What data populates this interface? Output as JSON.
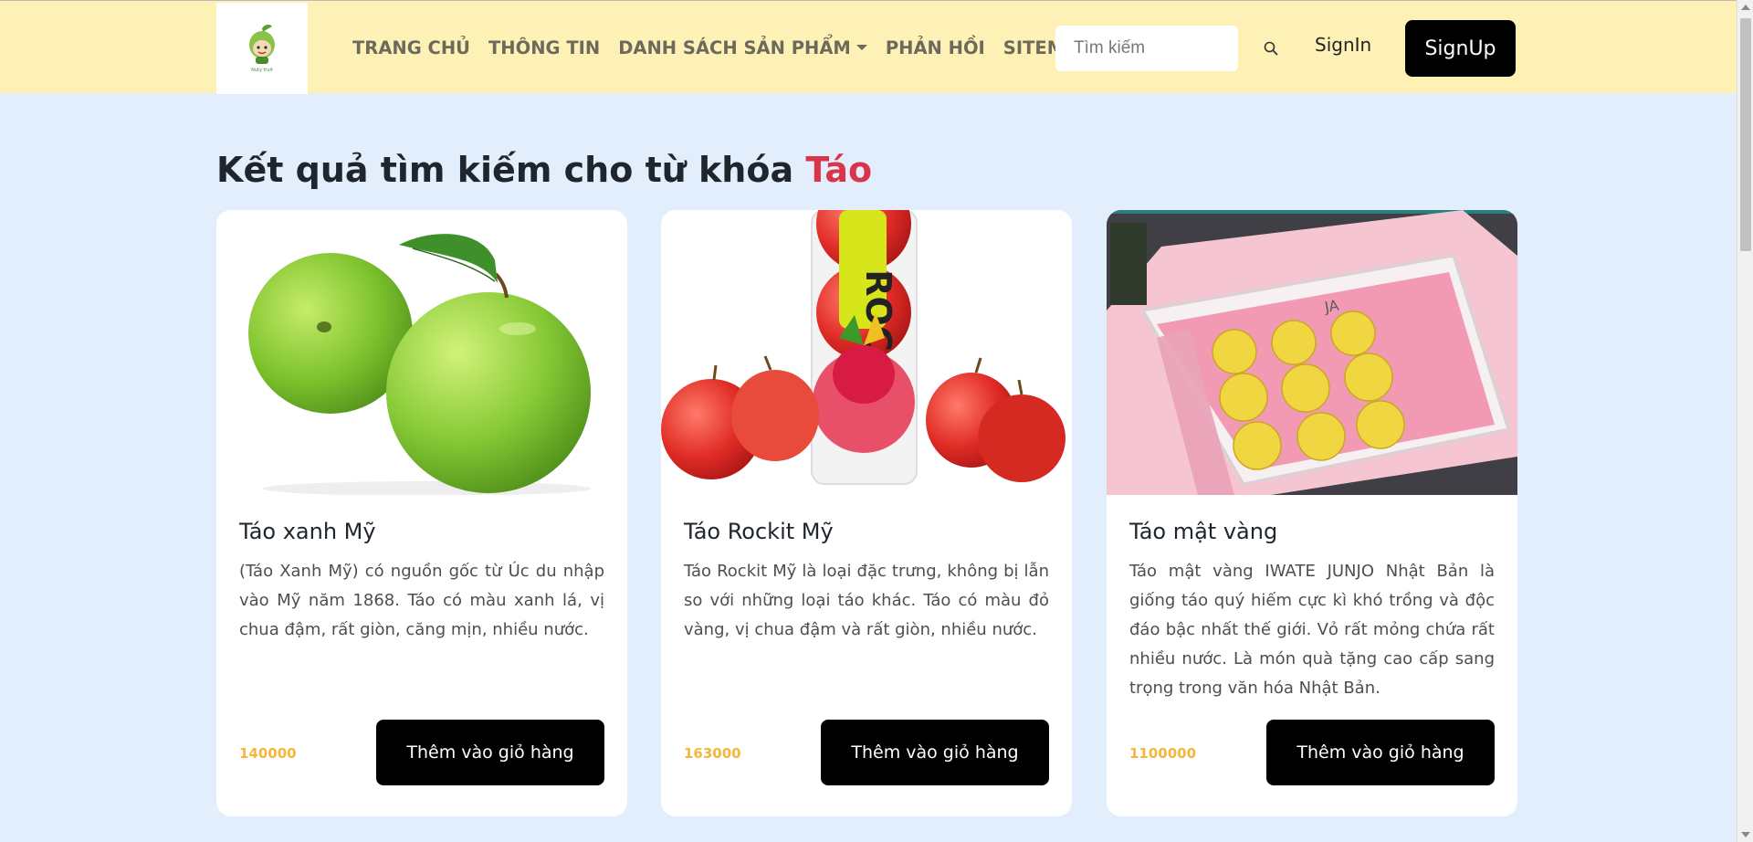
{
  "header": {
    "logo_icon": "fruit-shop-logo-icon",
    "nav": [
      {
        "label": "TRANG CHỦ"
      },
      {
        "label": "THÔNG TIN"
      },
      {
        "label": "DANH SÁCH SẢN PHẨM",
        "dropdown": true
      },
      {
        "label": "PHẢN HỒI"
      },
      {
        "label": "SITEMAP"
      }
    ],
    "search_placeholder": "Tìm kiếm",
    "search_icon": "search-icon",
    "signin_label": "SignIn",
    "signup_label": "SignUp"
  },
  "main": {
    "title_prefix": "Kết quả tìm kiếm cho từ khóa",
    "keyword": "Táo"
  },
  "products": [
    {
      "name": "Táo xanh Mỹ",
      "description": "(Táo Xanh Mỹ) có nguồn gốc từ Úc du nhập vào Mỹ năm 1868. Táo có màu xanh lá, vị chua đậm, rất giòn, căng mịn, nhiều nước.",
      "price": "140000",
      "button_label": "Thêm vào giỏ hàng"
    },
    {
      "name": "Táo Rockit Mỹ",
      "description": "Táo Rockit Mỹ là loại đặc trưng, không bị lẫn so với những loại táo khác. Táo có màu đỏ vàng, vị chua đậm và rất giòn, nhiều nước.",
      "price": "163000",
      "button_label": "Thêm vào giỏ hàng"
    },
    {
      "name": "Táo mật vàng",
      "description": "Táo mật vàng IWATE JUNJO Nhật Bản là giống táo quý hiếm cực kì khó trồng và độc đáo bậc nhất thế giới. Vỏ rất mỏng chứa rất nhiều nước. Là món quà tặng cao cấp sang trọng trong văn hóa Nhật Bản.",
      "price": "1100000",
      "button_label": "Thêm vào giỏ hàng"
    }
  ],
  "colors": {
    "header_bg": "#fef1b6",
    "page_bg": "#e3eefd",
    "keyword": "#d8344a",
    "price": "#f4b73a",
    "button_bg": "#000000"
  }
}
